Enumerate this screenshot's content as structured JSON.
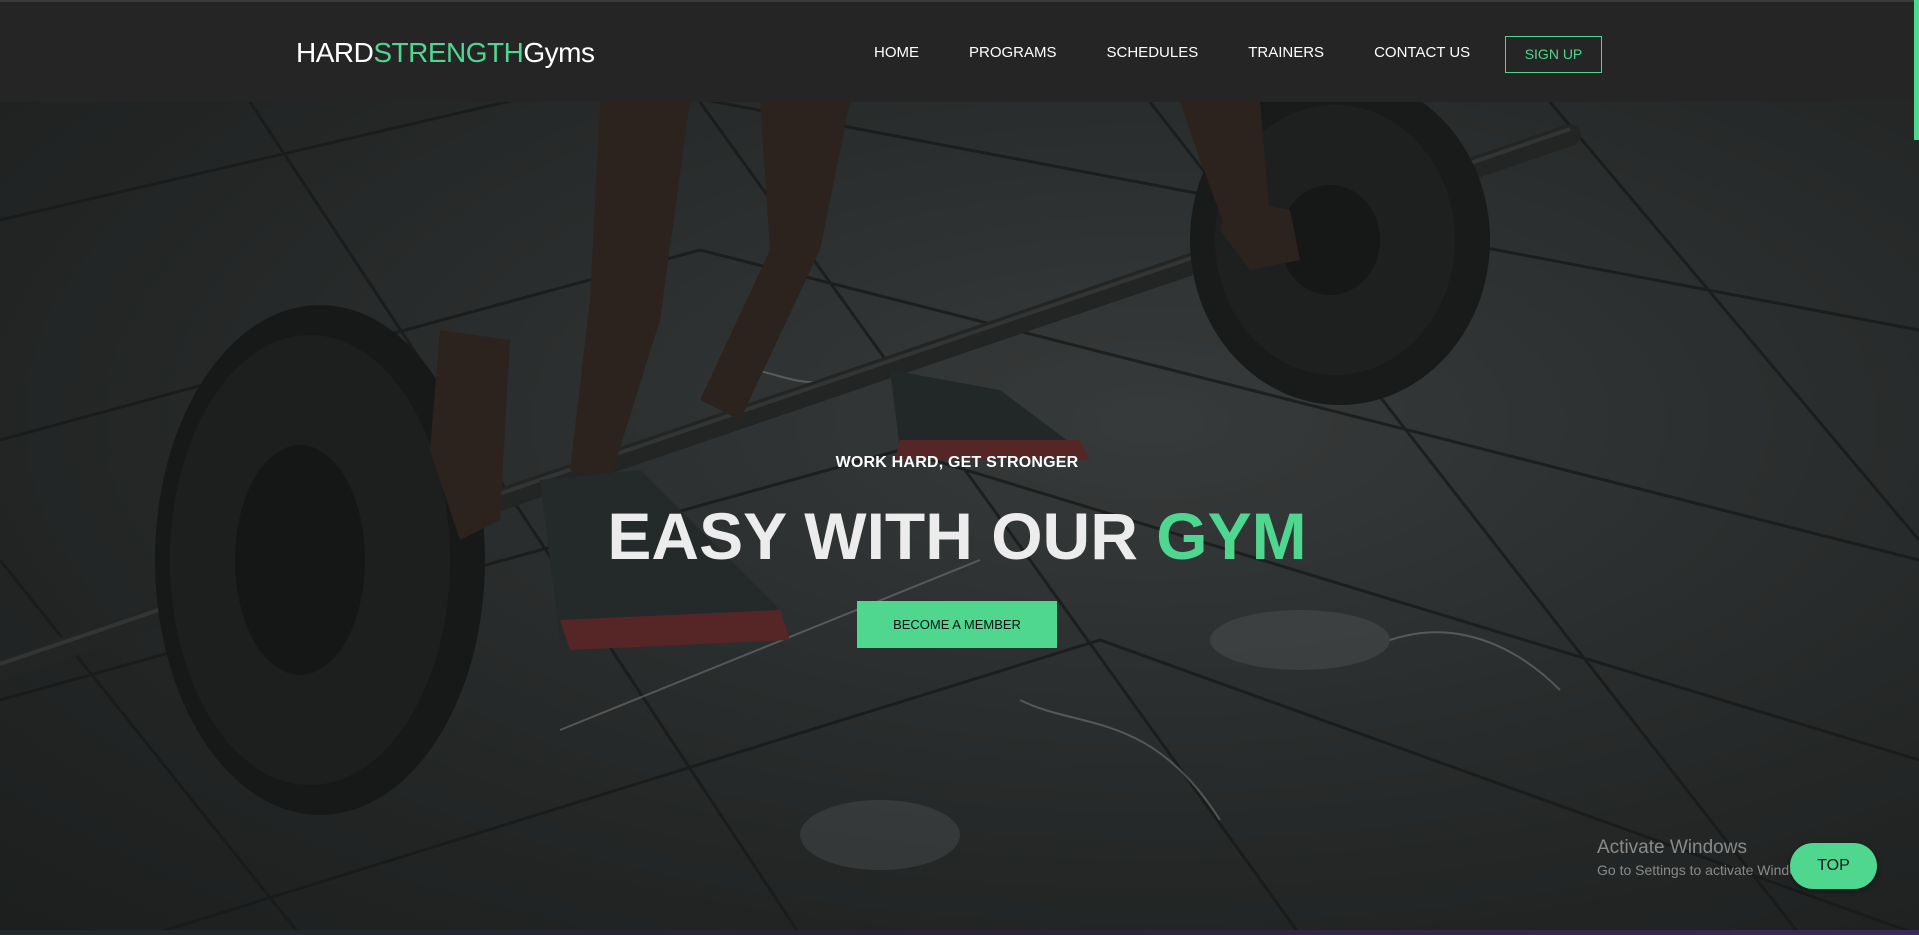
{
  "header": {
    "logo": {
      "part1": "HARD",
      "part2": "STRENGTH",
      "part3": "Gyms"
    },
    "nav": [
      {
        "label": "HOME"
      },
      {
        "label": "PROGRAMS"
      },
      {
        "label": "SCHEDULES"
      },
      {
        "label": "TRAINERS"
      },
      {
        "label": "CONTACT US"
      }
    ],
    "signup_label": "SIGN UP"
  },
  "hero": {
    "tagline": "WORK HARD, GET STRONGER",
    "headline_main": "EASY WITH OUR ",
    "headline_accent": "GYM",
    "cta_label": "BECOME A MEMBER",
    "background_image": "barbell-deadlift-photo"
  },
  "watermark": {
    "title": "Activate Windows",
    "subtitle": "Go to Settings to activate Windows."
  },
  "top_button_label": "TOP",
  "colors": {
    "accent": "#4fd68f",
    "header_bg": "#252525",
    "text_light": "#ffffff"
  }
}
